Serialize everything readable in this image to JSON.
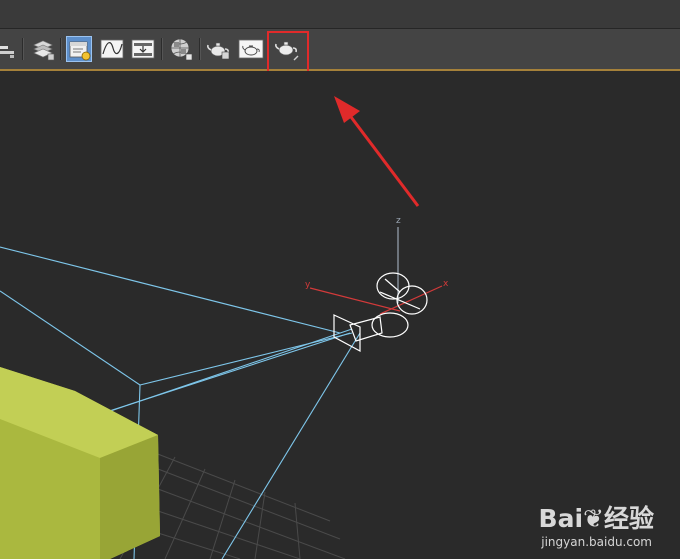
{
  "toolbar": {
    "buttons": [
      {
        "name": "align-tool-button",
        "icon": "align-icon"
      },
      {
        "name": "layer-manager-button",
        "icon": "layers-icon"
      },
      {
        "name": "scene-explorer-button",
        "icon": "scene-explorer-icon",
        "active": true
      },
      {
        "name": "curve-editor-button",
        "icon": "curve-editor-icon"
      },
      {
        "name": "schematic-view-button",
        "icon": "schematic-view-icon"
      },
      {
        "name": "material-editor-button",
        "icon": "material-editor-icon"
      },
      {
        "name": "render-setup-button",
        "icon": "render-setup-teapot-icon"
      },
      {
        "name": "rendered-frame-window-button",
        "icon": "rendered-frame-teapot-icon"
      },
      {
        "name": "render-production-button",
        "icon": "render-teapot-icon",
        "highlighted": true
      }
    ]
  },
  "viewport": {
    "axis_labels": {
      "x": "x",
      "y": "y",
      "z": "z"
    },
    "box_color": "#b5c247",
    "frustum_color": "#7ec6ea",
    "annotation_color": "#e02a2a"
  },
  "watermark": {
    "logo": "Bai❦经验",
    "url": "jingyan.baidu.com"
  }
}
